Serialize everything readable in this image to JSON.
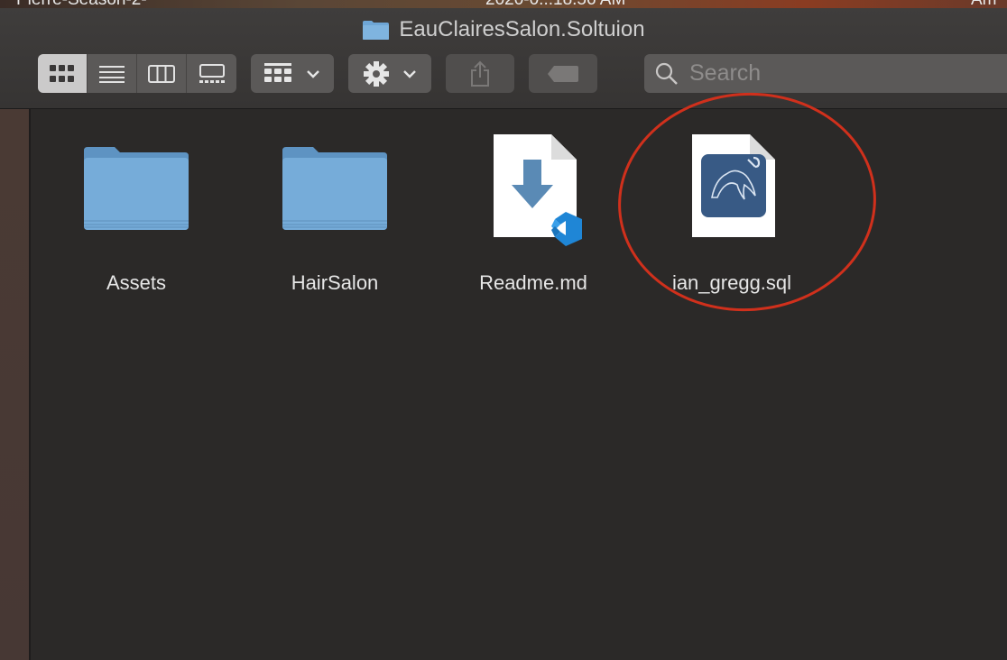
{
  "desktop": {
    "bg_fragments": [
      "Pierre-Season-2-",
      "2020-0...18.56 AM",
      "Am"
    ]
  },
  "window": {
    "title": "EauClairesSalon.Soltuion",
    "toolbar": {
      "view_icons": "icon-view-button",
      "search_placeholder": "Search"
    }
  },
  "files": [
    {
      "name": "Assets",
      "kind": "folder"
    },
    {
      "name": "HairSalon",
      "kind": "folder"
    },
    {
      "name": "Readme.md",
      "kind": "markdown-vscode"
    },
    {
      "name": "ian_gregg.sql",
      "kind": "mysql-file"
    }
  ],
  "colors": {
    "folder_blue": "#6ea6d6",
    "annotation_red": "#d0301c",
    "window_bg": "#2c2928"
  }
}
